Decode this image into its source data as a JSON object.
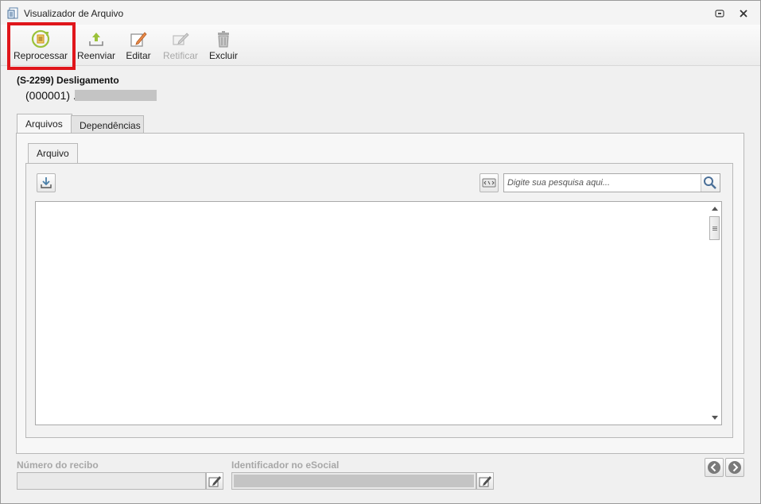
{
  "window": {
    "title": "Visualizador de Arquivo"
  },
  "toolbar": {
    "buttons": [
      {
        "label": "Reprocessar",
        "icon": "reprocess-icon",
        "enabled": true
      },
      {
        "label": "Reenviar",
        "icon": "upload-icon",
        "enabled": true
      },
      {
        "label": "Editar",
        "icon": "edit-icon",
        "enabled": true
      },
      {
        "label": "Retificar",
        "icon": "rectify-icon",
        "enabled": false
      },
      {
        "label": "Excluir",
        "icon": "trash-icon",
        "enabled": true
      }
    ],
    "highlighted": "Reprocessar"
  },
  "event": {
    "title": "(S-2299) Desligamento",
    "id_prefix": "(000001) ."
  },
  "tabs": [
    "Arquivos",
    "Dependências"
  ],
  "active_tab": "Arquivos",
  "inner_tabs": [
    "Arquivo"
  ],
  "search": {
    "placeholder": "Digite sua pesquisa aqui..."
  },
  "footer": {
    "receipt_label": "Número do recibo",
    "esocial_label": "Identificador no eSocial"
  },
  "colors": {
    "highlight": "#e0161b",
    "masked": "#c4c4c4",
    "disabled_text": "#a9a9a9",
    "reprocess_icon": "#9bc23a"
  }
}
